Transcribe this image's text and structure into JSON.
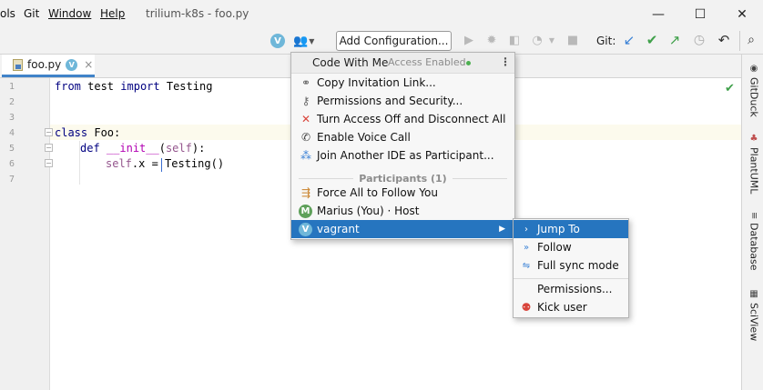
{
  "menu": [
    "ols",
    "Git",
    "Window",
    "Help"
  ],
  "window_title": "trilium-k8s - foo.py",
  "window_controls": {
    "minimize": "—",
    "maximize": "☐",
    "close": "✕"
  },
  "toolbar": {
    "avatar_letter": "V",
    "add_configuration": "Add Configuration...",
    "git_label": "Git:"
  },
  "tab": {
    "label": "foo.py",
    "avatar_letter": "V",
    "close": "×"
  },
  "editor": {
    "line_numbers": [
      "1",
      "2",
      "3",
      "4",
      "5",
      "6",
      "7"
    ],
    "lines": [
      {
        "kw": "from",
        "a": " test ",
        "kw2": "import",
        "b": " Testing"
      },
      {},
      {},
      {
        "kw": "class",
        "a": " Foo:"
      },
      {
        "kw": "def",
        "fn": "__init__",
        "a": "(",
        "self": "self",
        "b": "):"
      },
      {
        "self": "self",
        "a": ".x = Testing()"
      },
      {}
    ]
  },
  "right_panel": [
    "GitDuck",
    "PlantUML",
    "Database",
    "SciView"
  ],
  "popup": {
    "title": "Code With Me",
    "status": "Access Enabled",
    "items": [
      {
        "icon": "link-icon",
        "glyph": "🔗",
        "label": "Copy Invitation Link..."
      },
      {
        "icon": "key-icon",
        "glyph": "🔑",
        "label": "Permissions and Security..."
      },
      {
        "icon": "red-x-icon",
        "glyph": "✕",
        "label": "Turn Access Off and Disconnect All"
      },
      {
        "icon": "phone-icon",
        "glyph": "📞",
        "label": "Enable Voice Call"
      },
      {
        "icon": "join-icon",
        "glyph": "⁂",
        "label": "Join Another IDE as Participant..."
      }
    ],
    "participants_header": "Participants (1)",
    "participant_items": [
      {
        "label": "Force All to Follow You"
      },
      {
        "avatar": "M",
        "label": "Marius (You) · Host"
      },
      {
        "avatar": "V",
        "label": "vagrant"
      }
    ]
  },
  "submenu": {
    "items": [
      "Jump To",
      "Follow",
      "Full sync mode"
    ],
    "items2": [
      "Permissions...",
      "Kick user"
    ]
  },
  "colors": {
    "accent": "#2675bf",
    "avatar_v": "#6fb7d9",
    "avatar_m": "#5ea05a",
    "status_dot": "#4caf50"
  }
}
